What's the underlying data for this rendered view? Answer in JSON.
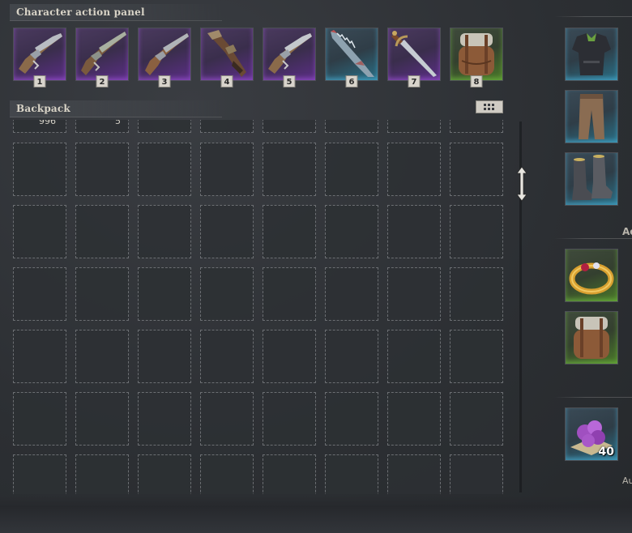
{
  "action_panel": {
    "title": "Character action panel",
    "slots": [
      {
        "number": "1",
        "item": "flintlock-pistol",
        "rarity": "purple"
      },
      {
        "number": "2",
        "item": "flintlock-pistol",
        "rarity": "purple"
      },
      {
        "number": "3",
        "item": "flintlock-pistol",
        "rarity": "purple"
      },
      {
        "number": "4",
        "item": "blunderbuss",
        "rarity": "purple"
      },
      {
        "number": "5",
        "item": "flintlock-pistol",
        "rarity": "purple"
      },
      {
        "number": "6",
        "item": "shark-saw-blade",
        "rarity": "blue"
      },
      {
        "number": "7",
        "item": "saber",
        "rarity": "purple"
      },
      {
        "number": "8",
        "item": "backpack",
        "rarity": "green"
      }
    ]
  },
  "backpack": {
    "title": "Backpack",
    "partial_top_counts": [
      "996",
      "5"
    ],
    "columns": 8,
    "visible_rows": 6
  },
  "equipment": {
    "slots": [
      {
        "item": "coat-armor",
        "rarity": "blue"
      },
      {
        "item": "trousers",
        "rarity": "blue"
      },
      {
        "item": "boots",
        "rarity": "blue"
      }
    ]
  },
  "accessories": {
    "title_fragment": "Ac",
    "slots": [
      {
        "item": "gold-ring",
        "rarity": "green"
      },
      {
        "item": "backpack",
        "rarity": "green"
      }
    ]
  },
  "resources": {
    "slots": [
      {
        "item": "purple-crystals",
        "rarity": "blue",
        "count": "40"
      }
    ],
    "label_fragment": "Au"
  },
  "icons": {
    "grid_toggle": "grid-view-icon",
    "resize": "vertical-resize-arrow-icon"
  },
  "colors": {
    "rarity_purple": "#5b2e86",
    "rarity_blue": "#2a6f86",
    "rarity_green": "#4b7a2a",
    "background": "#2f3236"
  }
}
